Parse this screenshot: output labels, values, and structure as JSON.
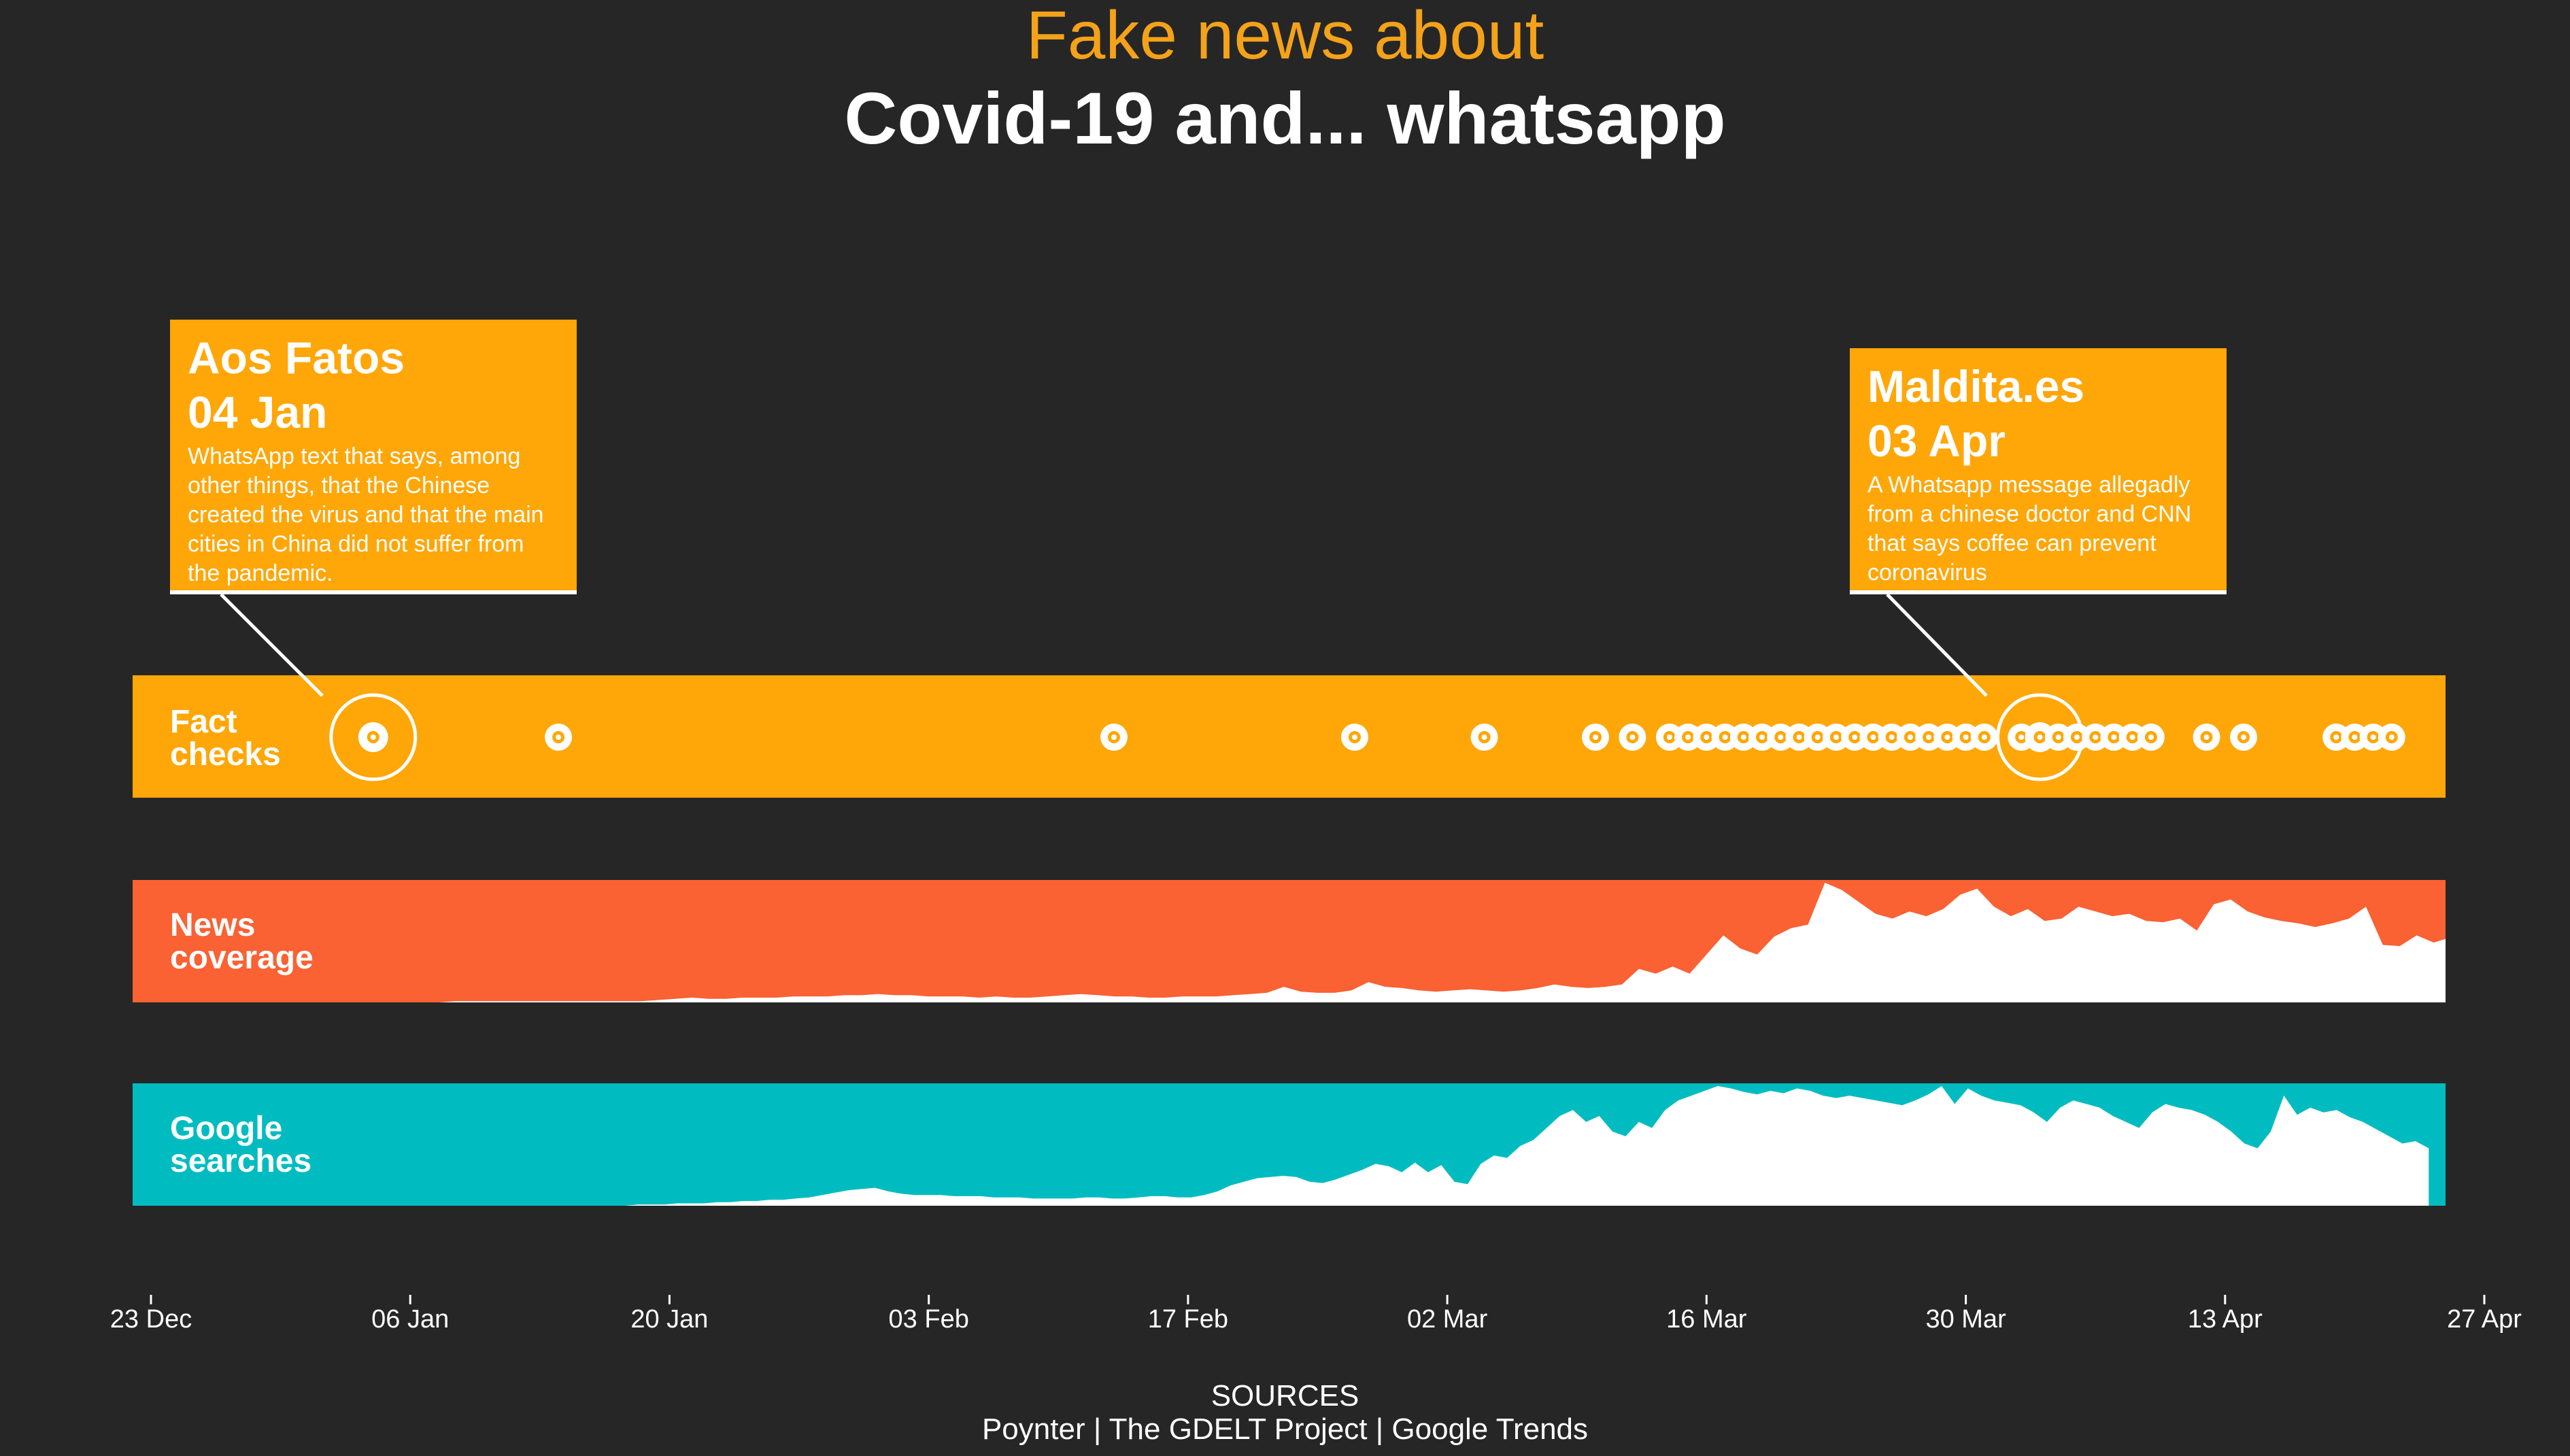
{
  "title": {
    "line1": "Fake news about",
    "line2": "Covid-19 and... whatsapp"
  },
  "colors": {
    "background": "#262626",
    "fact_checks": "#ffa608",
    "news_coverage": "#fa6133",
    "google_searches": "#00bcc0",
    "fill": "#ffffff"
  },
  "bands": {
    "fact_checks": [
      "Fact",
      "checks"
    ],
    "news_coverage": [
      "News",
      "coverage"
    ],
    "google_searches": [
      "Google",
      "searches"
    ]
  },
  "callouts": [
    {
      "source": "Aos Fatos",
      "date": "04 Jan",
      "text": [
        "WhatsApp text that says, among",
        "other things, that the Chinese",
        "created the virus and that the main",
        "cities in China did not suffer from",
        "the pandemic."
      ]
    },
    {
      "source": "Maldita.es",
      "date": "03 Apr",
      "text": [
        "A Whatsapp message allegadly",
        "from a chinese doctor and CNN",
        "that says coffee can prevent",
        "coronavirus"
      ]
    }
  ],
  "sources": {
    "heading": "SOURCES",
    "text": "Poynter | The GDELT Project | Google Trends"
  },
  "chart_data": {
    "type": "area",
    "x_axis": {
      "start": "2019-12-23",
      "end": "2020-04-27",
      "ticks": [
        "23 Dec",
        "06 Jan",
        "20 Jan",
        "03 Feb",
        "17 Feb",
        "02 Mar",
        "16 Mar",
        "30 Mar",
        "13 Apr",
        "27 Apr"
      ]
    },
    "fact_checks": {
      "dates": [
        "2020-01-04",
        "2020-01-14",
        "2020-02-13",
        "2020-02-26",
        "2020-03-04",
        "2020-03-10",
        "2020-03-12",
        "2020-03-14",
        "2020-03-15",
        "2020-03-16",
        "2020-03-17",
        "2020-03-18",
        "2020-03-19",
        "2020-03-20",
        "2020-03-21",
        "2020-03-22",
        "2020-03-23",
        "2020-03-24",
        "2020-03-25",
        "2020-03-26",
        "2020-03-27",
        "2020-03-28",
        "2020-03-29",
        "2020-03-30",
        "2020-03-31",
        "2020-04-02",
        "2020-04-03",
        "2020-04-04",
        "2020-04-05",
        "2020-04-06",
        "2020-04-07",
        "2020-04-08",
        "2020-04-09",
        "2020-04-12",
        "2020-04-14",
        "2020-04-19",
        "2020-04-20",
        "2020-04-21",
        "2020-04-22"
      ],
      "highlighted": [
        "2020-01-04",
        "2020-04-03"
      ]
    },
    "series": [
      {
        "name": "News coverage",
        "values": [
          0,
          0,
          0,
          0,
          0,
          0,
          0,
          0,
          0,
          0,
          0,
          0,
          0,
          0,
          0,
          0,
          0,
          0,
          1,
          1,
          1,
          1,
          1,
          1,
          1,
          1,
          1,
          1,
          1,
          1,
          2,
          3,
          4,
          3,
          3,
          4,
          4,
          4,
          5,
          5,
          5,
          6,
          6,
          7,
          6,
          6,
          5,
          5,
          5,
          4,
          5,
          4,
          4,
          5,
          6,
          7,
          6,
          5,
          5,
          4,
          4,
          5,
          5,
          5,
          6,
          7,
          8,
          13,
          9,
          8,
          8,
          10,
          17,
          13,
          12,
          10,
          9,
          10,
          11,
          10,
          9,
          10,
          12,
          15,
          13,
          12,
          13,
          15,
          28,
          24,
          30,
          24,
          40,
          56,
          45,
          40,
          55,
          62,
          65,
          100,
          94,
          84,
          74,
          70,
          76,
          72,
          78,
          90,
          95,
          80,
          72,
          78,
          68,
          70,
          80,
          76,
          72,
          74,
          68,
          67,
          70,
          60,
          82,
          86,
          76,
          71,
          68,
          66,
          63,
          66,
          70,
          80,
          48,
          47,
          56,
          50,
          53,
          48,
          56
        ]
      },
      {
        "name": "Google searches",
        "values": [
          0,
          0,
          0,
          0,
          0,
          0,
          0,
          0,
          0,
          0,
          0,
          0,
          0,
          0,
          0,
          0,
          0,
          0,
          0,
          0,
          0,
          0,
          0,
          0,
          0,
          0,
          0,
          0,
          0,
          0,
          0,
          0,
          0,
          0,
          0,
          0,
          0,
          1,
          1,
          1,
          2,
          2,
          2,
          3,
          3,
          4,
          4,
          5,
          5,
          6,
          7,
          9,
          11,
          13,
          14,
          15,
          12,
          10,
          9,
          9,
          9,
          8,
          8,
          8,
          7,
          7,
          7,
          6,
          6,
          6,
          6,
          7,
          7,
          6,
          6,
          7,
          8,
          8,
          7,
          7,
          9,
          12,
          17,
          20,
          23,
          24,
          25,
          24,
          20,
          19,
          22,
          26,
          30,
          35,
          33,
          28,
          36,
          28,
          34,
          20,
          18,
          35,
          42,
          40,
          50,
          55,
          65,
          75,
          80,
          70,
          75,
          62,
          58,
          70,
          65,
          80,
          88,
          92,
          96,
          100,
          98,
          95,
          93,
          96,
          94,
          98,
          96,
          92,
          90,
          92,
          90,
          88,
          86,
          84,
          88,
          93,
          100,
          85,
          98,
          92,
          88,
          86,
          84,
          78,
          70,
          82,
          88,
          85,
          82,
          75,
          70,
          65,
          78,
          85,
          82,
          80,
          76,
          70,
          62,
          52,
          48,
          62,
          92,
          76,
          82,
          78,
          80,
          74,
          70,
          64,
          58,
          52,
          54,
          48
        ],
        "end_date": "2020-04-24"
      }
    ],
    "title": "Fake news about Covid-19 and... whatsapp",
    "grid": false,
    "legend": "none"
  }
}
